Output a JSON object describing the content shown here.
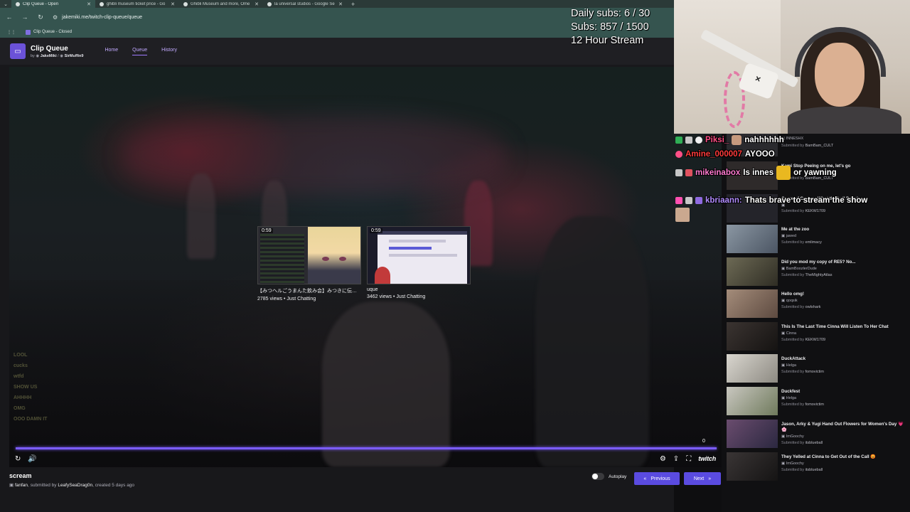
{
  "browser": {
    "tabs": [
      {
        "label": "Clip Queue - Open",
        "active": true
      },
      {
        "label": "ghibli museum ticket price - Go",
        "active": false
      },
      {
        "label": "Ghibli Museum and more, Ome",
        "active": false
      },
      {
        "label": "la universal studios - Google Se",
        "active": false
      }
    ],
    "new_tab": "+",
    "url": "jakemiki.me/twitch-clip-queue/queue",
    "bookmark": "Clip Queue - Closed"
  },
  "app": {
    "title": "Clip Queue",
    "by_prefix": "by",
    "authors": [
      "JakeMiki",
      "SirMuffin9"
    ],
    "nav": [
      {
        "label": "Home",
        "active": false
      },
      {
        "label": "Queue",
        "active": true
      },
      {
        "label": "History",
        "active": false
      }
    ]
  },
  "player": {
    "counter": "0",
    "progress_fraction": 1.0,
    "brand": "twitch",
    "recommendations": [
      {
        "time": "0:59",
        "title": "【みつヘルごうまんた飲み会】みつきに伝統…",
        "meta": "2785 views • Just Chatting"
      },
      {
        "time": "0:59",
        "title": "uque",
        "meta": "3462 views • Just Chatting"
      }
    ],
    "ghost_chat": [
      {
        "user": "",
        "text": "LOOL"
      },
      {
        "user": "",
        "text": "cucks"
      },
      {
        "user": "",
        "text": "wtfd"
      },
      {
        "user": "",
        "text": "SHOW US"
      },
      {
        "user": "",
        "text": "AHHHH"
      },
      {
        "user": "",
        "text": "OMG"
      },
      {
        "user": "",
        "text": ""
      },
      {
        "user": "",
        "text": "OOO DAMN IT"
      }
    ]
  },
  "clip": {
    "title": "scream",
    "channel": "fanfan",
    "submitted_by_prefix": "submitted by",
    "submitter": "LeafySeaDrag0n",
    "created": "created 5 days ago"
  },
  "controls": {
    "autoplay_label": "Autoplay",
    "previous_label": "Previous",
    "next_label": "Next"
  },
  "overlay": {
    "daily_subs": "Daily subs: 6 / 30",
    "subs": "Subs: 857 / 1500",
    "stream_length": "12 Hour Stream"
  },
  "chat": [
    {
      "user": "Piksi_",
      "text": "nahhhhhh",
      "color": "#ff4f86"
    },
    {
      "user": "Amine_000007",
      "text": "AYOOO",
      "color": "#ff3b3b"
    },
    {
      "user": "mikeinabox",
      "text": "Is innes",
      "color": "#ff7ad0"
    },
    {
      "user": "",
      "text": "or yawning",
      "color": "#ffffff"
    },
    {
      "user": "kbriaann:",
      "text": "Thats brave to stream the show",
      "color": "#b18cff"
    }
  ],
  "queue": {
    "submitted_prefix": "Submitted by",
    "items": [
      {
        "title": "",
        "creator": "INNESHX",
        "submitter": "BamBam_CULT"
      },
      {
        "title": "Kami Stop Peeing on me, let's go",
        "creator": "",
        "submitter": "BamBam_CULT"
      },
      {
        "title": "Game of Codes - What the hell Dave!",
        "creator": "",
        "submitter": "KEKW1709"
      },
      {
        "title": "Me at the zoo",
        "creator": "jawed",
        "submitter": "emlimacy"
      },
      {
        "title": "Did you mod my copy of RE5? No...",
        "creator": "BamBoozlerDude",
        "submitter": "TheMightyAtlas"
      },
      {
        "title": "Hello omg!",
        "creator": "qoqsik",
        "submitter": "owlshark"
      },
      {
        "title": "This Is The Last Time Cinna Will Listen To Her Chat",
        "creator": "Cinna",
        "submitter": "KEKW1709"
      },
      {
        "title": "DuckAttack",
        "creator": "Helga",
        "submitter": "fomovictim"
      },
      {
        "title": "Duckfest",
        "creator": "Helga",
        "submitter": "fomovictim"
      },
      {
        "title": "Jason, Arky & Yugi Hand Out Flowers for Women's Day 💗🌸",
        "creator": "ImGoochy",
        "submitter": "itsblueball"
      },
      {
        "title": "They Yelled at Cinna to Get Out of the Call 😡",
        "creator": "ImGoochy",
        "submitter": "itsblueball"
      }
    ]
  }
}
